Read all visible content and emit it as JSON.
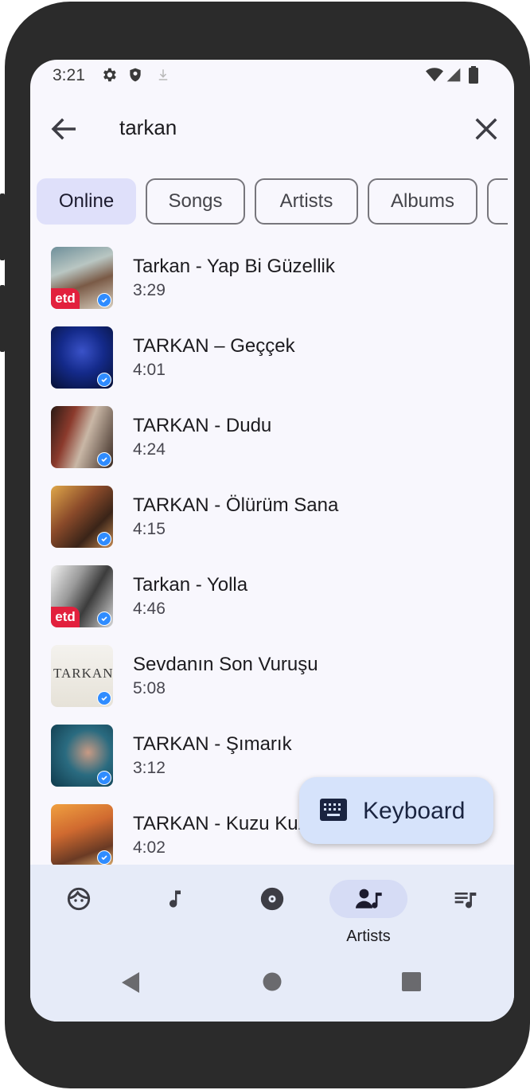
{
  "status_bar": {
    "time": "3:21",
    "left_icons": [
      "settings-icon",
      "shield-icon",
      "download-icon"
    ],
    "right_icons": [
      "wifi-icon",
      "signal-icon",
      "battery-icon"
    ]
  },
  "search": {
    "query": "tarkan",
    "back_icon": "arrow-left-icon",
    "clear_icon": "close-icon"
  },
  "filter_chips": [
    {
      "label": "Online",
      "selected": true
    },
    {
      "label": "Songs",
      "selected": false
    },
    {
      "label": "Artists",
      "selected": false
    },
    {
      "label": "Albums",
      "selected": false
    },
    {
      "label": "",
      "selected": false
    }
  ],
  "results": [
    {
      "title": "Tarkan - Yap Bi Güzellik",
      "duration": "3:29",
      "label": "etd",
      "verified": true
    },
    {
      "title": "TARKAN – Geççek",
      "duration": "4:01",
      "verified": true
    },
    {
      "title": "TARKAN - Dudu",
      "duration": "4:24",
      "verified": true
    },
    {
      "title": "TARKAN - Ölürüm Sana",
      "duration": "4:15",
      "verified": true
    },
    {
      "title": "Tarkan - Yolla",
      "duration": "4:46",
      "label": "etd",
      "verified": true
    },
    {
      "title": "Sevdanın Son Vuruşu",
      "duration": "5:08",
      "cover_text": "TARKAN",
      "verified": true
    },
    {
      "title": "TARKAN - Şımarık",
      "duration": "3:12",
      "verified": true
    },
    {
      "title": "TARKAN - Kuzu Kuzu",
      "duration": "4:02",
      "verified": true
    }
  ],
  "fab": {
    "label": "Keyboard",
    "icon": "keyboard-icon"
  },
  "bottom_nav": {
    "items": [
      {
        "icon": "face-icon",
        "label": ""
      },
      {
        "icon": "music-note-icon",
        "label": ""
      },
      {
        "icon": "album-icon",
        "label": ""
      },
      {
        "icon": "artist-icon",
        "label": "Artists",
        "active": true
      },
      {
        "icon": "playlist-icon",
        "label": ""
      }
    ]
  },
  "system_nav": [
    "back-triangle-icon",
    "home-circle-icon",
    "recents-square-icon"
  ],
  "colors": {
    "background": "#f8f7fd",
    "selected_chip": "#dfe0fa",
    "fab": "#d6e3fb",
    "nav_bar": "#e6ebf8",
    "verified_badge": "#2f8cff"
  }
}
